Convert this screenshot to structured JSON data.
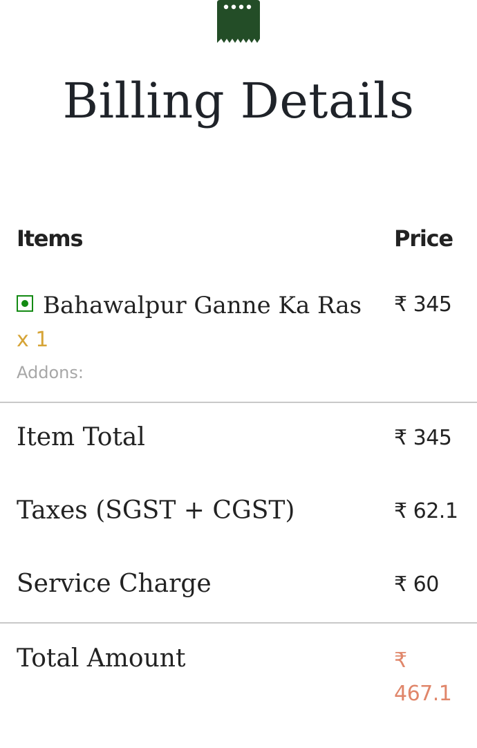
{
  "page": {
    "title": "Billing Details"
  },
  "table": {
    "items_header": "Items",
    "price_header": "Price"
  },
  "items": [
    {
      "name": "Bahawalpur Ganne Ka Ras",
      "quantity": "x 1",
      "price": "₹ 345",
      "addons_label": "Addons:",
      "veg": true
    }
  ],
  "summary": {
    "item_total_label": "Item Total",
    "item_total_value": "₹ 345",
    "taxes_label": "Taxes (SGST + CGST)",
    "taxes_value": "₹ 62.1",
    "service_label": "Service Charge",
    "service_value": "₹ 60",
    "total_label": "Total Amount",
    "total_currency": "₹",
    "total_value": "467.1"
  },
  "icons": {
    "header_icon": "receipt-icon",
    "veg_indicator": "veg-indicator-icon"
  },
  "colors": {
    "brand_green": "#234d27",
    "veg_green": "#138a13",
    "quantity_gold": "#d6a436",
    "total_accent": "#e0866a",
    "addons_gray": "#a7a7a7",
    "divider": "#c8c8c8"
  }
}
